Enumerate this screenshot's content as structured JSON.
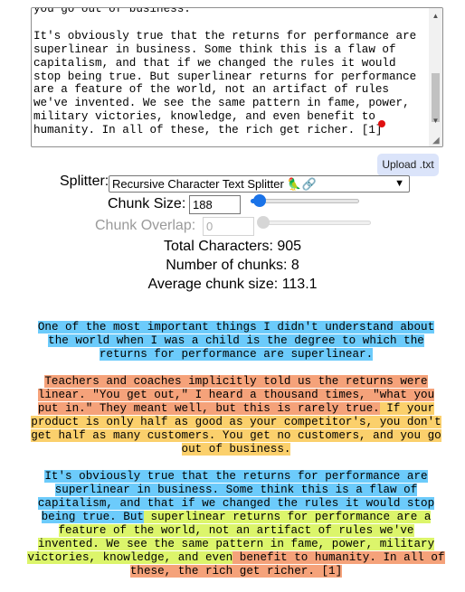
{
  "textarea": {
    "lines": [
      "you go out of business.",
      "",
      "It's obviously true that the returns for performance are superlinear in business. Some think this is a flaw of capitalism, and that if we changed the rules it would stop being true. But superlinear returns for performance are a feature of the world, not an artifact of rules we've invented. We see the same pattern in fame, power, military victories, knowledge, and even benefit to humanity. In all of these, the rich get richer. [1]"
    ]
  },
  "upload_button": {
    "label": "Upload .txt"
  },
  "splitter": {
    "label": "Splitter:",
    "selected": "Recursive Character Text Splitter 🦜🔗"
  },
  "chunk_size": {
    "label": "Chunk Size:",
    "value": "188"
  },
  "chunk_overlap": {
    "label": "Chunk Overlap:",
    "value": "0"
  },
  "stats": {
    "total_characters": "Total Characters: 905",
    "number_of_chunks": "Number of chunks: 8",
    "average_chunk_size": "Average chunk size: 113.1"
  },
  "colors": {
    "blue": "#6ccbfb",
    "orange": "#f5a27a",
    "yellow": "#fbd06c",
    "lime": "#dcf56b"
  },
  "chunks": {
    "p1": {
      "c1": "One of the most important things I didn't understand about the world when I was a child is the degree to which the returns for performance are superlinear."
    },
    "p2": {
      "c2": "Teachers and coaches implicitly told us the returns were linear. \"You get out,\" I heard a thousand times, \"what you put in.\" They meant well, but this is rarely true.",
      "c3": " If your product is only half as good as your competitor's, you don't get half as many customers. You get no customers, and you go out of business."
    },
    "p3": {
      "c4": "It's obviously true that the returns for performance are superlinear in business. Some think this is a flaw of capitalism, and that if we changed the rules it would stop being true. But",
      "c5": " superlinear returns for performance are a feature of the world, not an artifact of rules we've invented. We see the same pattern in fame, power, military victories, knowledge, and even",
      "c6": " benefit to humanity. In all of these, the rich get richer. [1]"
    }
  }
}
